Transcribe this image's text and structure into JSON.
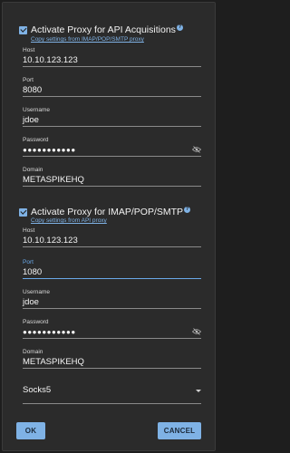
{
  "api_proxy": {
    "title": "Activate Proxy for API Acquisitions",
    "copy_link": "Copy settings from IMAP/POP/SMTP proxy",
    "host_label": "Host",
    "host_value": "10.10.123.123",
    "port_label": "Port",
    "port_value": "8080",
    "username_label": "Username",
    "username_value": "jdoe",
    "password_label": "Password",
    "password_value": "●●●●●●●●●●●",
    "domain_label": "Domain",
    "domain_value": "METASPIKEHQ"
  },
  "imap_proxy": {
    "title": "Activate Proxy for IMAP/POP/SMTP",
    "copy_link": "Copy settings from API proxy",
    "host_label": "Host",
    "host_value": "10.10.123.123",
    "port_label": "Port",
    "port_value": "1080",
    "username_label": "Username",
    "username_value": "jdoe",
    "password_label": "Password",
    "password_value": "●●●●●●●●●●●",
    "domain_label": "Domain",
    "domain_value": "METASPIKEHQ",
    "proxy_type": "Socks5"
  },
  "buttons": {
    "ok": "OK",
    "cancel": "CANCEL"
  },
  "colors": {
    "accent": "#7fb2e5",
    "background": "#2b2b2b"
  }
}
